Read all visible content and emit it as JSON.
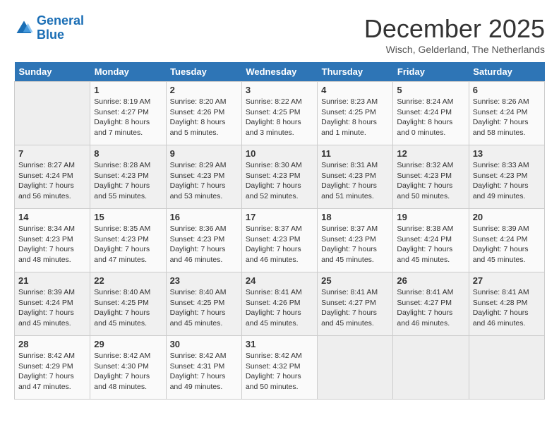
{
  "logo": {
    "line1": "General",
    "line2": "Blue"
  },
  "title": "December 2025",
  "subtitle": "Wisch, Gelderland, The Netherlands",
  "weekdays": [
    "Sunday",
    "Monday",
    "Tuesday",
    "Wednesday",
    "Thursday",
    "Friday",
    "Saturday"
  ],
  "weeks": [
    [
      {
        "day": "",
        "sunrise": "",
        "sunset": "",
        "daylight": ""
      },
      {
        "day": "1",
        "sunrise": "Sunrise: 8:19 AM",
        "sunset": "Sunset: 4:27 PM",
        "daylight": "Daylight: 8 hours and 7 minutes."
      },
      {
        "day": "2",
        "sunrise": "Sunrise: 8:20 AM",
        "sunset": "Sunset: 4:26 PM",
        "daylight": "Daylight: 8 hours and 5 minutes."
      },
      {
        "day": "3",
        "sunrise": "Sunrise: 8:22 AM",
        "sunset": "Sunset: 4:25 PM",
        "daylight": "Daylight: 8 hours and 3 minutes."
      },
      {
        "day": "4",
        "sunrise": "Sunrise: 8:23 AM",
        "sunset": "Sunset: 4:25 PM",
        "daylight": "Daylight: 8 hours and 1 minute."
      },
      {
        "day": "5",
        "sunrise": "Sunrise: 8:24 AM",
        "sunset": "Sunset: 4:24 PM",
        "daylight": "Daylight: 8 hours and 0 minutes."
      },
      {
        "day": "6",
        "sunrise": "Sunrise: 8:26 AM",
        "sunset": "Sunset: 4:24 PM",
        "daylight": "Daylight: 7 hours and 58 minutes."
      }
    ],
    [
      {
        "day": "7",
        "sunrise": "Sunrise: 8:27 AM",
        "sunset": "Sunset: 4:24 PM",
        "daylight": "Daylight: 7 hours and 56 minutes."
      },
      {
        "day": "8",
        "sunrise": "Sunrise: 8:28 AM",
        "sunset": "Sunset: 4:23 PM",
        "daylight": "Daylight: 7 hours and 55 minutes."
      },
      {
        "day": "9",
        "sunrise": "Sunrise: 8:29 AM",
        "sunset": "Sunset: 4:23 PM",
        "daylight": "Daylight: 7 hours and 53 minutes."
      },
      {
        "day": "10",
        "sunrise": "Sunrise: 8:30 AM",
        "sunset": "Sunset: 4:23 PM",
        "daylight": "Daylight: 7 hours and 52 minutes."
      },
      {
        "day": "11",
        "sunrise": "Sunrise: 8:31 AM",
        "sunset": "Sunset: 4:23 PM",
        "daylight": "Daylight: 7 hours and 51 minutes."
      },
      {
        "day": "12",
        "sunrise": "Sunrise: 8:32 AM",
        "sunset": "Sunset: 4:23 PM",
        "daylight": "Daylight: 7 hours and 50 minutes."
      },
      {
        "day": "13",
        "sunrise": "Sunrise: 8:33 AM",
        "sunset": "Sunset: 4:23 PM",
        "daylight": "Daylight: 7 hours and 49 minutes."
      }
    ],
    [
      {
        "day": "14",
        "sunrise": "Sunrise: 8:34 AM",
        "sunset": "Sunset: 4:23 PM",
        "daylight": "Daylight: 7 hours and 48 minutes."
      },
      {
        "day": "15",
        "sunrise": "Sunrise: 8:35 AM",
        "sunset": "Sunset: 4:23 PM",
        "daylight": "Daylight: 7 hours and 47 minutes."
      },
      {
        "day": "16",
        "sunrise": "Sunrise: 8:36 AM",
        "sunset": "Sunset: 4:23 PM",
        "daylight": "Daylight: 7 hours and 46 minutes."
      },
      {
        "day": "17",
        "sunrise": "Sunrise: 8:37 AM",
        "sunset": "Sunset: 4:23 PM",
        "daylight": "Daylight: 7 hours and 46 minutes."
      },
      {
        "day": "18",
        "sunrise": "Sunrise: 8:37 AM",
        "sunset": "Sunset: 4:23 PM",
        "daylight": "Daylight: 7 hours and 45 minutes."
      },
      {
        "day": "19",
        "sunrise": "Sunrise: 8:38 AM",
        "sunset": "Sunset: 4:24 PM",
        "daylight": "Daylight: 7 hours and 45 minutes."
      },
      {
        "day": "20",
        "sunrise": "Sunrise: 8:39 AM",
        "sunset": "Sunset: 4:24 PM",
        "daylight": "Daylight: 7 hours and 45 minutes."
      }
    ],
    [
      {
        "day": "21",
        "sunrise": "Sunrise: 8:39 AM",
        "sunset": "Sunset: 4:24 PM",
        "daylight": "Daylight: 7 hours and 45 minutes."
      },
      {
        "day": "22",
        "sunrise": "Sunrise: 8:40 AM",
        "sunset": "Sunset: 4:25 PM",
        "daylight": "Daylight: 7 hours and 45 minutes."
      },
      {
        "day": "23",
        "sunrise": "Sunrise: 8:40 AM",
        "sunset": "Sunset: 4:25 PM",
        "daylight": "Daylight: 7 hours and 45 minutes."
      },
      {
        "day": "24",
        "sunrise": "Sunrise: 8:41 AM",
        "sunset": "Sunset: 4:26 PM",
        "daylight": "Daylight: 7 hours and 45 minutes."
      },
      {
        "day": "25",
        "sunrise": "Sunrise: 8:41 AM",
        "sunset": "Sunset: 4:27 PM",
        "daylight": "Daylight: 7 hours and 45 minutes."
      },
      {
        "day": "26",
        "sunrise": "Sunrise: 8:41 AM",
        "sunset": "Sunset: 4:27 PM",
        "daylight": "Daylight: 7 hours and 46 minutes."
      },
      {
        "day": "27",
        "sunrise": "Sunrise: 8:41 AM",
        "sunset": "Sunset: 4:28 PM",
        "daylight": "Daylight: 7 hours and 46 minutes."
      }
    ],
    [
      {
        "day": "28",
        "sunrise": "Sunrise: 8:42 AM",
        "sunset": "Sunset: 4:29 PM",
        "daylight": "Daylight: 7 hours and 47 minutes."
      },
      {
        "day": "29",
        "sunrise": "Sunrise: 8:42 AM",
        "sunset": "Sunset: 4:30 PM",
        "daylight": "Daylight: 7 hours and 48 minutes."
      },
      {
        "day": "30",
        "sunrise": "Sunrise: 8:42 AM",
        "sunset": "Sunset: 4:31 PM",
        "daylight": "Daylight: 7 hours and 49 minutes."
      },
      {
        "day": "31",
        "sunrise": "Sunrise: 8:42 AM",
        "sunset": "Sunset: 4:32 PM",
        "daylight": "Daylight: 7 hours and 50 minutes."
      },
      {
        "day": "",
        "sunrise": "",
        "sunset": "",
        "daylight": ""
      },
      {
        "day": "",
        "sunrise": "",
        "sunset": "",
        "daylight": ""
      },
      {
        "day": "",
        "sunrise": "",
        "sunset": "",
        "daylight": ""
      }
    ]
  ]
}
